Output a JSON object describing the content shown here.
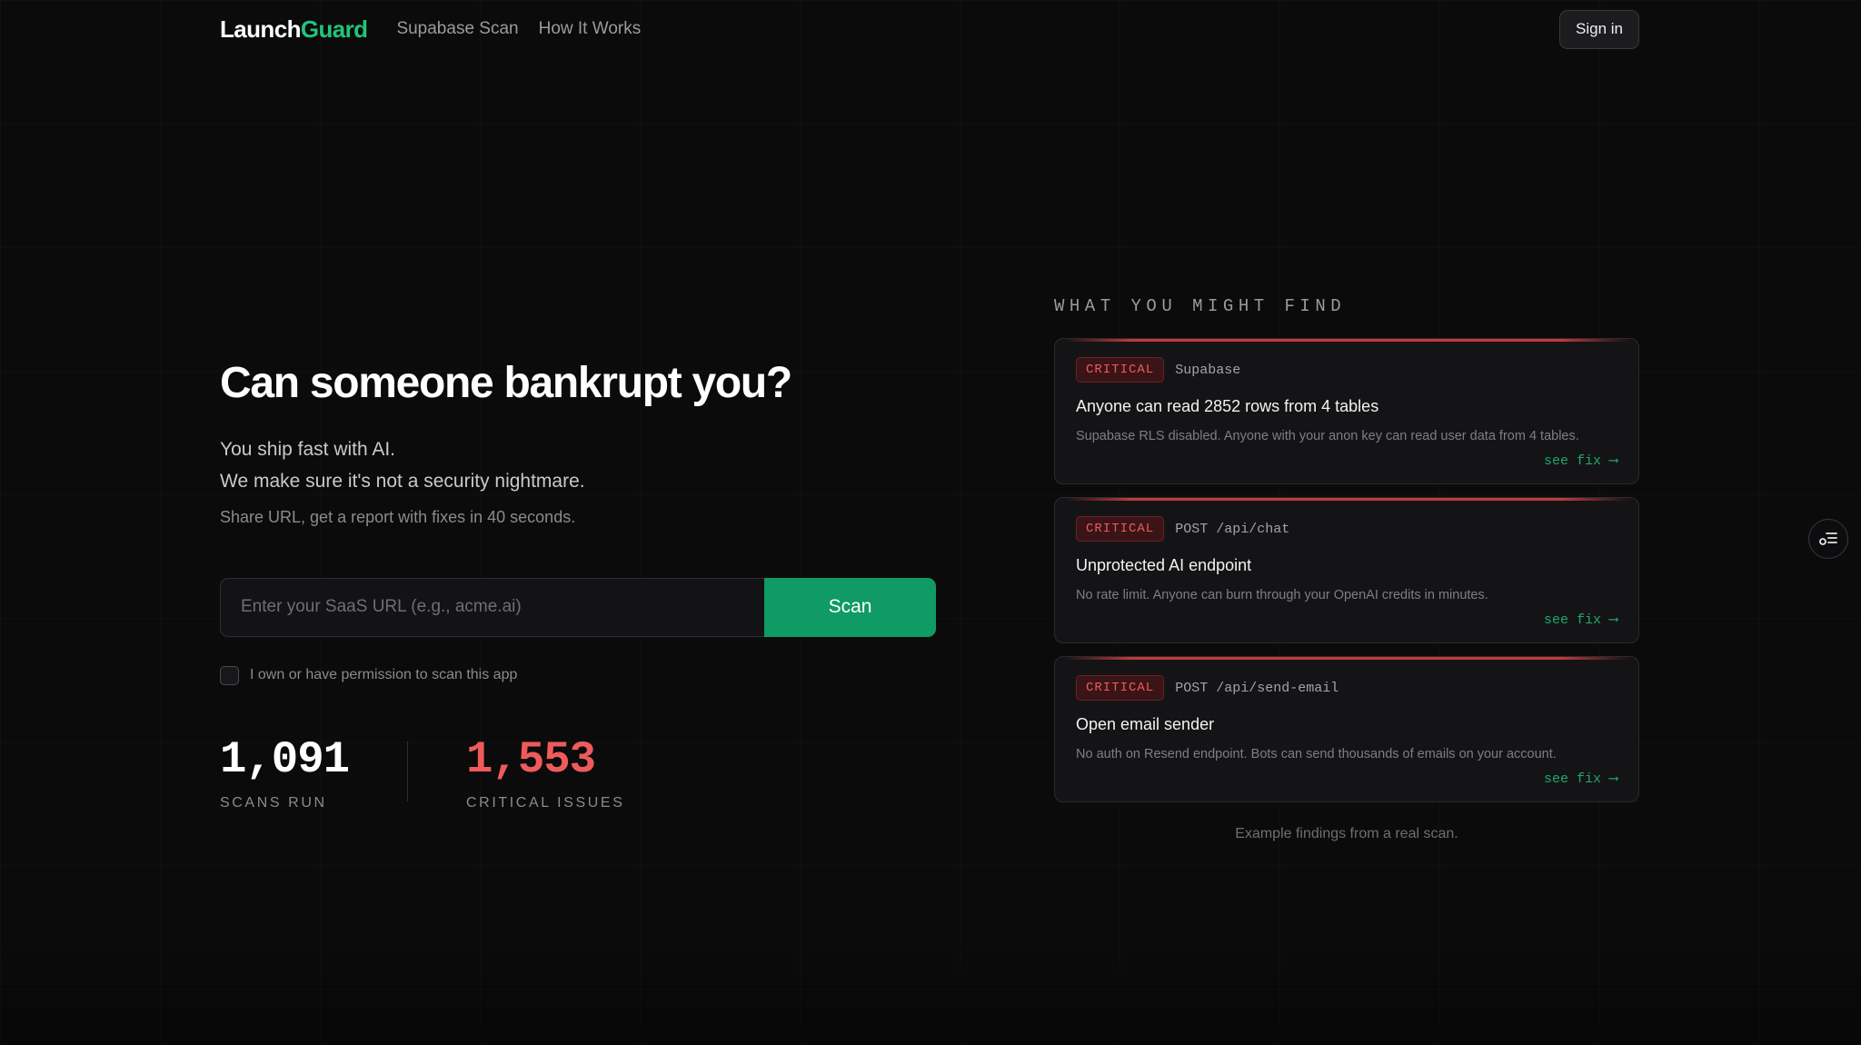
{
  "nav": {
    "logo_part1": "Launch",
    "logo_part2": "Guard",
    "links": [
      "Supabase Scan",
      "How It Works"
    ],
    "signin": "Sign in"
  },
  "hero": {
    "headline": "Can someone bankrupt you?",
    "subline1": "You ship fast with AI.",
    "subline2": "We make sure it's not a security nightmare.",
    "subline3": "Share URL, get a report with fixes in 40 seconds.",
    "input_placeholder": "Enter your SaaS URL (e.g., acme.ai)",
    "input_value": "",
    "scan_button": "Scan",
    "permission_label": "I own or have permission to scan this app",
    "permission_checked": false
  },
  "stats": [
    {
      "value": "1,091",
      "label": "SCANS RUN"
    },
    {
      "value": "1,553",
      "label": "CRITICAL ISSUES"
    }
  ],
  "findings": {
    "title": "WHAT YOU MIGHT FIND",
    "cards": [
      {
        "severity": "CRITICAL",
        "source": "Supabase",
        "title": "Anyone can read 2852 rows from 4 tables",
        "description": "Supabase RLS disabled. Anyone with your anon key can read user data from 4 tables.",
        "link": "see fix ⟶"
      },
      {
        "severity": "CRITICAL",
        "source": "POST /api/chat",
        "title": "Unprotected AI endpoint",
        "description": "No rate limit. Anyone can burn through your OpenAI credits in minutes.",
        "link": "see fix ⟶"
      },
      {
        "severity": "CRITICAL",
        "source": "POST /api/send-email",
        "title": "Open email sender",
        "description": "No auth on Resend endpoint. Bots can send thousands of emails on your account.",
        "link": "see fix ⟶"
      }
    ],
    "footnote": "Example findings from a real scan."
  },
  "theme": {
    "accent_green": "#22c47a",
    "button_green": "#0f9b63",
    "critical_red": "#ef5b5b",
    "background": "#0b0b0c"
  },
  "icons": {
    "side_widget": "list-filter-icon"
  }
}
